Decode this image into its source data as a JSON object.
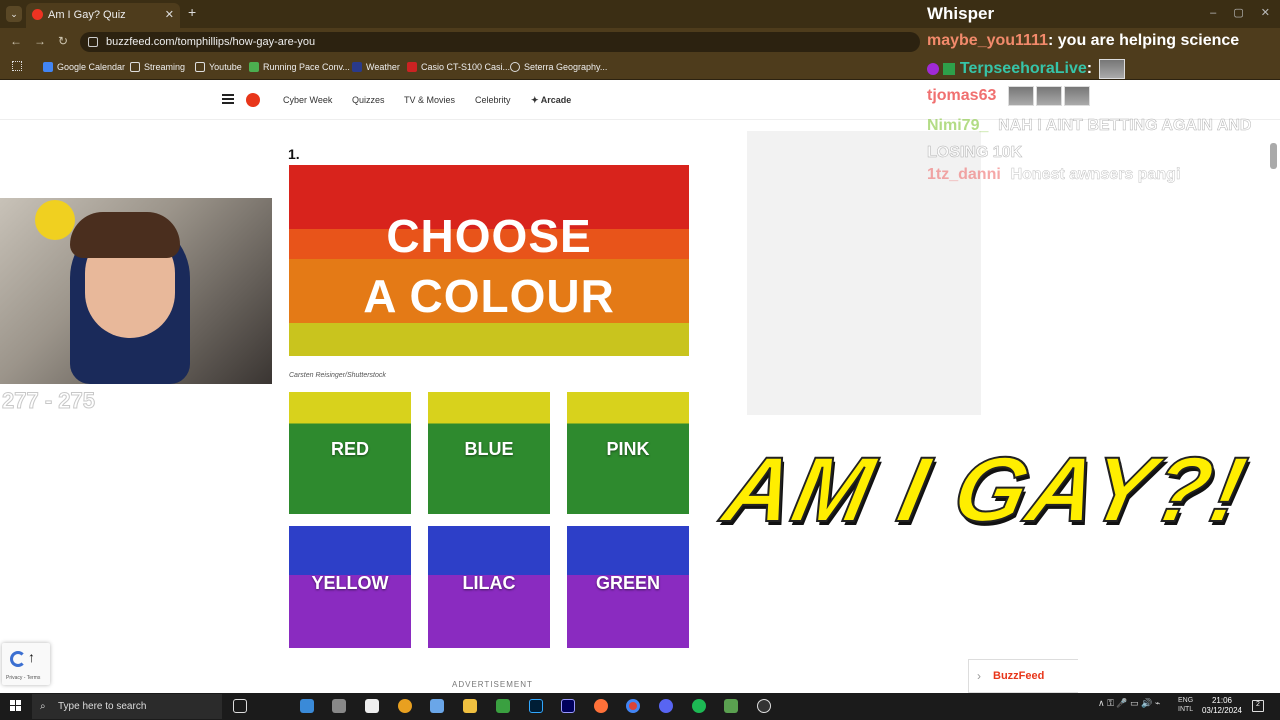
{
  "browser": {
    "tab_title": "Am I Gay? Quiz",
    "tab_close": "✕",
    "new_tab": "+",
    "url": "buzzfeed.com/tomphillips/how-gay-are-you",
    "window_controls": "–  ▢  ✕",
    "bookmarks": [
      "Google Calendar",
      "Streaming",
      "Youtube",
      "Running Pace Conv...",
      "Weather",
      "Casio CT-S100 Casi...",
      "Seterra Geography..."
    ]
  },
  "site": {
    "nav": [
      "Cyber Week",
      "Quizzes",
      "TV & Movies",
      "Celebrity",
      "Arcade"
    ],
    "question_number": "1.",
    "hero_line1": "CHOOSE",
    "hero_line2": "A COLOUR",
    "image_credit": "Carsten Reisinger/Shutterstock",
    "options": [
      "RED",
      "BLUE",
      "PINK",
      "YELLOW",
      "LILAC",
      "GREEN"
    ],
    "ad_label": "ADVERTISEMENT",
    "bottom_bar": "BuzzFeed",
    "recaptcha_terms": "Privacy - Terms",
    "colors": {
      "brand": "#e8361a"
    }
  },
  "stream": {
    "counter": "277 - 275",
    "chat_title": "Whisper",
    "chat": [
      {
        "user": "maybe_you1111",
        "msg": "you are helping science",
        "color": "#f28a6b"
      },
      {
        "user": "TerpseehoraLive",
        "msg": "",
        "color": "#36c4a8"
      },
      {
        "user": "tjomas63",
        "msg": "",
        "color": "#f07070"
      },
      {
        "user": "Nimi79_",
        "msg": "NAH I AINT BETTING AGAIN AND LOSING 10K",
        "color": "#9ad15e"
      },
      {
        "user": "1tz_danni",
        "msg": "Honest awnsers pangi",
        "color": "#f07070"
      }
    ],
    "big_title": "AM I GAY?!"
  },
  "taskbar": {
    "search_placeholder": "Type here to search",
    "lang_line1": "ENG",
    "lang_line2": "INTL",
    "time": "21:06",
    "date": "03/12/2024",
    "notifications": "2"
  }
}
